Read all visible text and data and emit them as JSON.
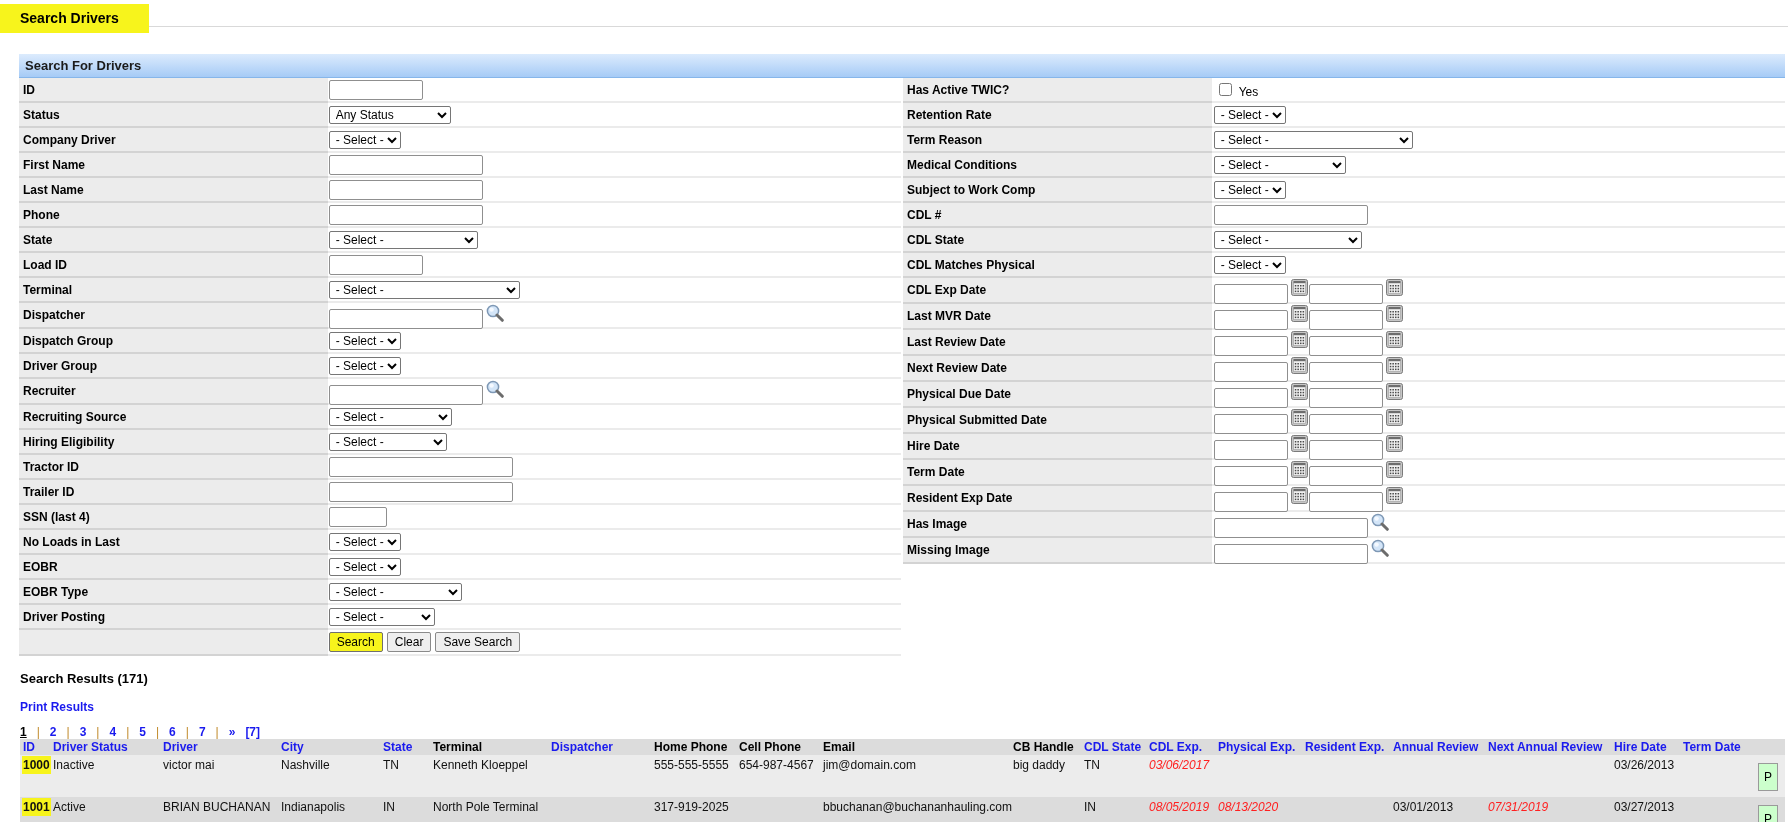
{
  "page": {
    "title": "Search Drivers",
    "highlighted": true
  },
  "search_panel": {
    "title": "Search For Drivers",
    "left_fields": [
      {
        "label": "ID",
        "kind": "text"
      },
      {
        "label": "Status",
        "kind": "select",
        "value": "Any Status"
      },
      {
        "label": "Company Driver",
        "kind": "select",
        "value": "- Select -"
      },
      {
        "label": "First Name",
        "kind": "text"
      },
      {
        "label": "Last Name",
        "kind": "text"
      },
      {
        "label": "Phone",
        "kind": "text"
      },
      {
        "label": "State",
        "kind": "select",
        "value": "- Select -"
      },
      {
        "label": "Load ID",
        "kind": "text"
      },
      {
        "label": "Terminal",
        "kind": "select",
        "value": "- Select -"
      },
      {
        "label": "Dispatcher",
        "kind": "lookup"
      },
      {
        "label": "Dispatch Group",
        "kind": "select",
        "value": "- Select -"
      },
      {
        "label": "Driver Group",
        "kind": "select",
        "value": "- Select -"
      },
      {
        "label": "Recruiter",
        "kind": "lookup"
      },
      {
        "label": "Recruiting Source",
        "kind": "select",
        "value": "- Select -"
      },
      {
        "label": "Hiring Eligibility",
        "kind": "select",
        "value": "- Select -"
      },
      {
        "label": "Tractor ID",
        "kind": "text"
      },
      {
        "label": "Trailer ID",
        "kind": "text"
      },
      {
        "label": "SSN (last 4)",
        "kind": "text"
      },
      {
        "label": "No Loads in Last",
        "kind": "select",
        "value": "- Select -"
      },
      {
        "label": "EOBR",
        "kind": "select",
        "value": "- Select -"
      },
      {
        "label": "EOBR Type",
        "kind": "select",
        "value": "- Select -"
      },
      {
        "label": "Driver Posting",
        "kind": "select",
        "value": "- Select -"
      }
    ],
    "buttons": [
      {
        "label": "Search",
        "highlighted": true
      },
      {
        "label": "Clear",
        "highlighted": false
      },
      {
        "label": "Save Search",
        "highlighted": false
      }
    ],
    "right_fields": [
      {
        "label": "Has Active TWIC?",
        "kind": "checkbox",
        "option": "Yes",
        "checked": false
      },
      {
        "label": "Retention Rate",
        "kind": "select",
        "value": "- Select -"
      },
      {
        "label": "Term Reason",
        "kind": "select",
        "value": "- Select -"
      },
      {
        "label": "Medical Conditions",
        "kind": "select",
        "value": "- Select -"
      },
      {
        "label": "Subject to Work Comp",
        "kind": "select",
        "value": "- Select -"
      },
      {
        "label": "CDL #",
        "kind": "text"
      },
      {
        "label": "CDL State",
        "kind": "select",
        "value": "- Select -"
      },
      {
        "label": "CDL Matches Physical",
        "kind": "select",
        "value": "- Select -"
      },
      {
        "label": "CDL Exp Date",
        "kind": "date_range"
      },
      {
        "label": "Last MVR Date",
        "kind": "date_range"
      },
      {
        "label": "Last Review Date",
        "kind": "date_range"
      },
      {
        "label": "Next Review Date",
        "kind": "date_range"
      },
      {
        "label": "Physical Due Date",
        "kind": "date_range"
      },
      {
        "label": "Physical Submitted Date",
        "kind": "date_range"
      },
      {
        "label": "Hire Date",
        "kind": "date_range"
      },
      {
        "label": "Term Date",
        "kind": "date_range"
      },
      {
        "label": "Resident Exp Date",
        "kind": "date_range"
      },
      {
        "label": "Has Image",
        "kind": "lookup"
      },
      {
        "label": "Missing Image",
        "kind": "lookup"
      }
    ]
  },
  "results": {
    "heading": "Search Results (171)",
    "print_link": "Print Results",
    "pagination": {
      "pages": [
        {
          "label": "1",
          "selected": true
        },
        {
          "label": "2",
          "selected": false
        },
        {
          "label": "3",
          "selected": false
        },
        {
          "label": "4",
          "selected": false
        },
        {
          "label": "5",
          "selected": false
        },
        {
          "label": "6",
          "selected": false
        },
        {
          "label": "7",
          "selected": false
        }
      ],
      "separator": "|",
      "next": "»",
      "last": "[7]"
    },
    "table": {
      "columns": [
        {
          "label": "ID",
          "sortable": true
        },
        {
          "label": "Driver Status",
          "sortable": true
        },
        {
          "label": "Driver",
          "sortable": true
        },
        {
          "label": "City",
          "sortable": true
        },
        {
          "label": "State",
          "sortable": true
        },
        {
          "label": "Terminal",
          "sortable": false
        },
        {
          "label": "Dispatcher",
          "sortable": true
        },
        {
          "label": "Home Phone",
          "sortable": false
        },
        {
          "label": "Cell Phone",
          "sortable": false
        },
        {
          "label": "Email",
          "sortable": false
        },
        {
          "label": "CB Handle",
          "sortable": false
        },
        {
          "label": "CDL State",
          "sortable": true
        },
        {
          "label": "CDL Exp.",
          "sortable": true
        },
        {
          "label": "Physical Exp.",
          "sortable": true
        },
        {
          "label": "Resident Exp.",
          "sortable": true
        },
        {
          "label": "Annual Review",
          "sortable": true
        },
        {
          "label": "Next Annual Review",
          "sortable": true
        },
        {
          "label": "Hire Date",
          "sortable": true
        },
        {
          "label": "Term Date",
          "sortable": true
        }
      ],
      "rows": [
        {
          "cells": [
            {
              "text": "1000",
              "highlighted": true
            },
            "Inactive",
            "victor mai",
            "Nashville",
            "TN",
            "Kenneth Kloeppel",
            null,
            "555-555-5555",
            "654-987-4567",
            "jim@domain.com",
            "big daddy",
            "TN",
            {
              "text": "03/06/2017",
              "expired": true
            },
            null,
            null,
            null,
            null,
            {
              "text": "03/26/2013",
              "expired": false
            },
            null
          ],
          "action": "P"
        },
        {
          "cells": [
            {
              "text": "1001",
              "highlighted": true
            },
            "Active",
            "BRIAN BUCHANAN",
            "Indianapolis",
            "IN",
            "North Pole Terminal",
            null,
            "317-919-2025",
            null,
            "bbuchanan@buchananhauling.com",
            null,
            "IN",
            {
              "text": "08/05/2019",
              "expired": true
            },
            {
              "text": "08/13/2020",
              "expired": true
            },
            null,
            {
              "text": "03/01/2013",
              "expired": false
            },
            {
              "text": "07/31/2019",
              "expired": true
            },
            {
              "text": "03/27/2013",
              "expired": false
            },
            null
          ],
          "action": "P"
        }
      ]
    }
  }
}
